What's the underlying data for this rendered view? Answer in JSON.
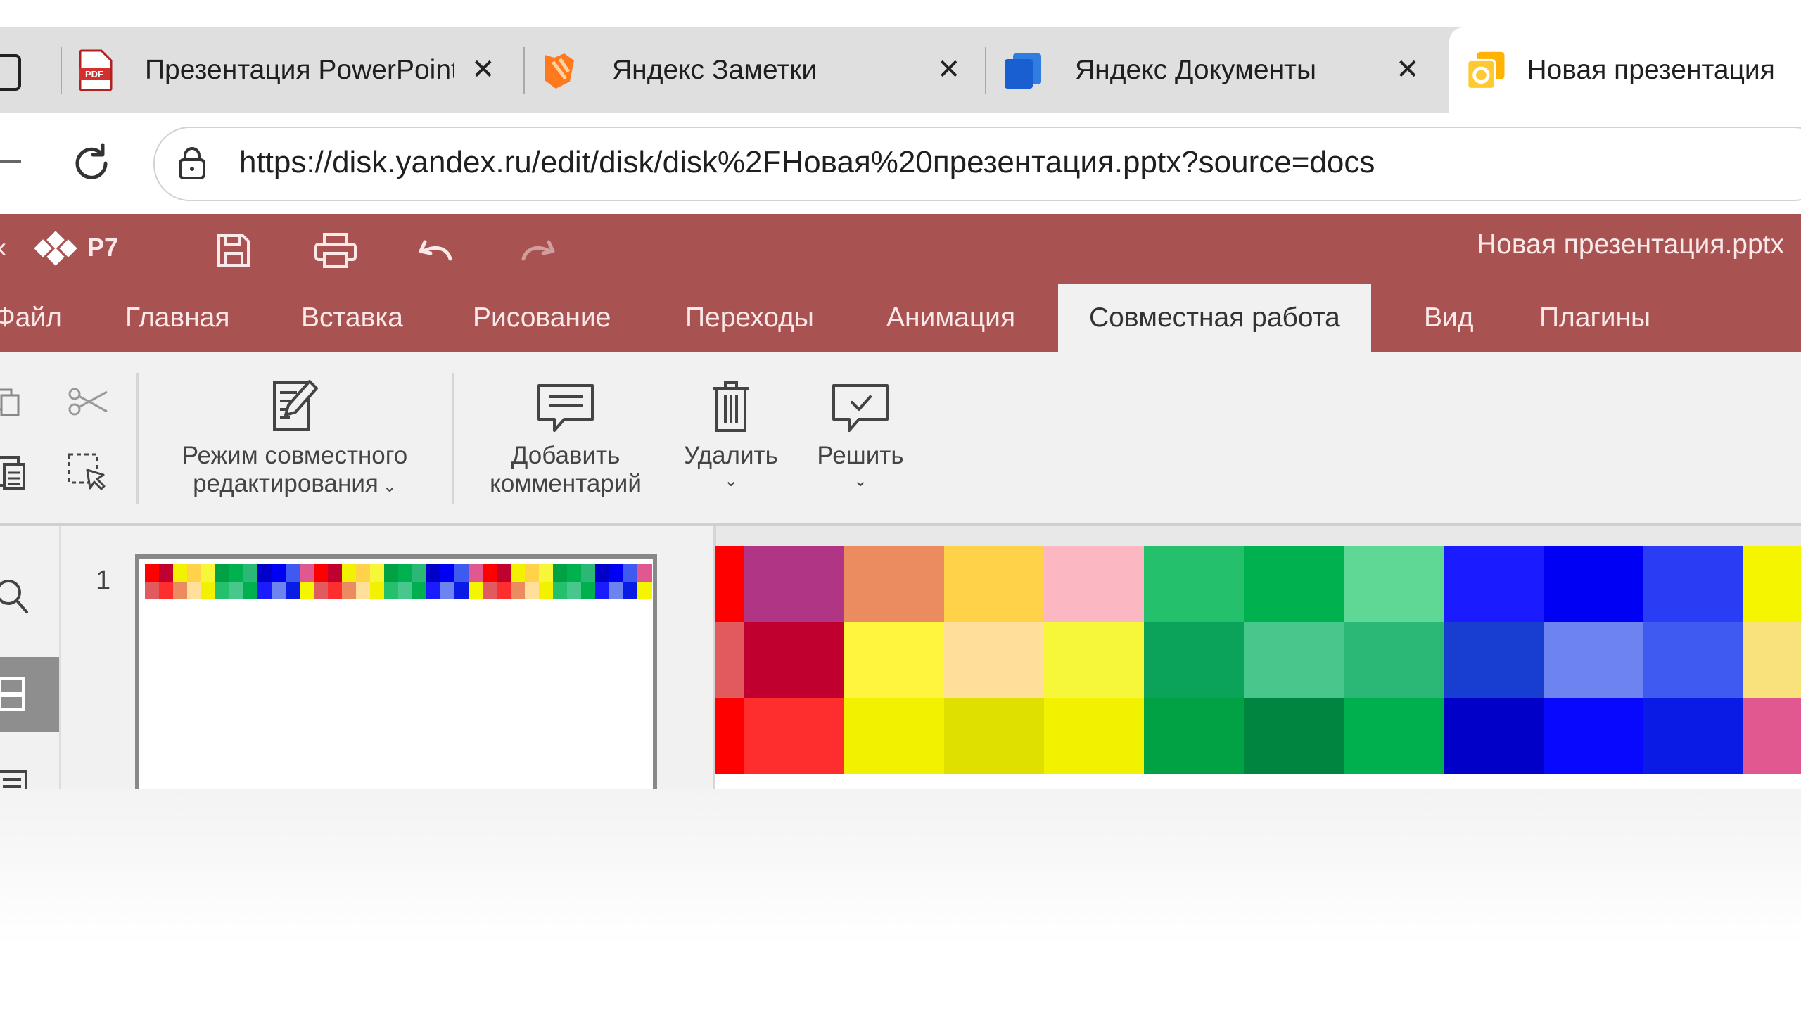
{
  "browser": {
    "tabs": [
      {
        "title": "Презентация PowerPoint",
        "icon": "pdf-icon"
      },
      {
        "title": "Яндекс Заметки",
        "icon": "notes-icon"
      },
      {
        "title": "Яндекс Документы",
        "icon": "documents-icon"
      },
      {
        "title": "Новая презентация",
        "icon": "presentation-icon"
      }
    ],
    "url": "https://disk.yandex.ru/edit/disk/disk%2FНовая%20презентация.pptx?source=docs"
  },
  "app": {
    "logo": "Р7",
    "doc_title": "Новая презентация.pptx",
    "menu": [
      "Файл",
      "Главная",
      "Вставка",
      "Рисование",
      "Переходы",
      "Анимация",
      "Совместная работа",
      "Вид",
      "Плагины"
    ],
    "active_menu": "Совместная работа"
  },
  "ribbon": {
    "co_edit_line1": "Режим совместного",
    "co_edit_line2": "редактирования",
    "add_comment_line1": "Добавить",
    "add_comment_line2": "комментарий",
    "delete": "Удалить",
    "resolve": "Решить"
  },
  "thumbnails": {
    "slide_number": "1"
  },
  "slide": {
    "stripe_colors": [
      [
        "#ff0000",
        "#e05a5e",
        "#ff0000"
      ],
      [
        "#b03584",
        "#c0002f",
        "#ff2e2e"
      ],
      [
        "#ea8c5f",
        "#fff53f",
        "#f2f200"
      ],
      [
        "#ffd24a",
        "#ffdf99",
        "#e0e000"
      ],
      [
        "#fbb8c2",
        "#f7f73a",
        "#f2f200"
      ],
      [
        "#25c06c",
        "#0ba35a",
        "#00a244"
      ],
      [
        "#00b14f",
        "#48c78d",
        "#008540"
      ],
      [
        "#5ed894",
        "#2bb877",
        "#00b04f"
      ],
      [
        "#1b1bff",
        "#173ed1",
        "#0000c9"
      ],
      [
        "#0000f5",
        "#6d83f0",
        "#0808ff"
      ],
      [
        "#2b3cf5",
        "#3e5af0",
        "#0a1be6"
      ],
      [
        "#f5f500",
        "#f9e27c",
        "#e0588f"
      ]
    ]
  }
}
